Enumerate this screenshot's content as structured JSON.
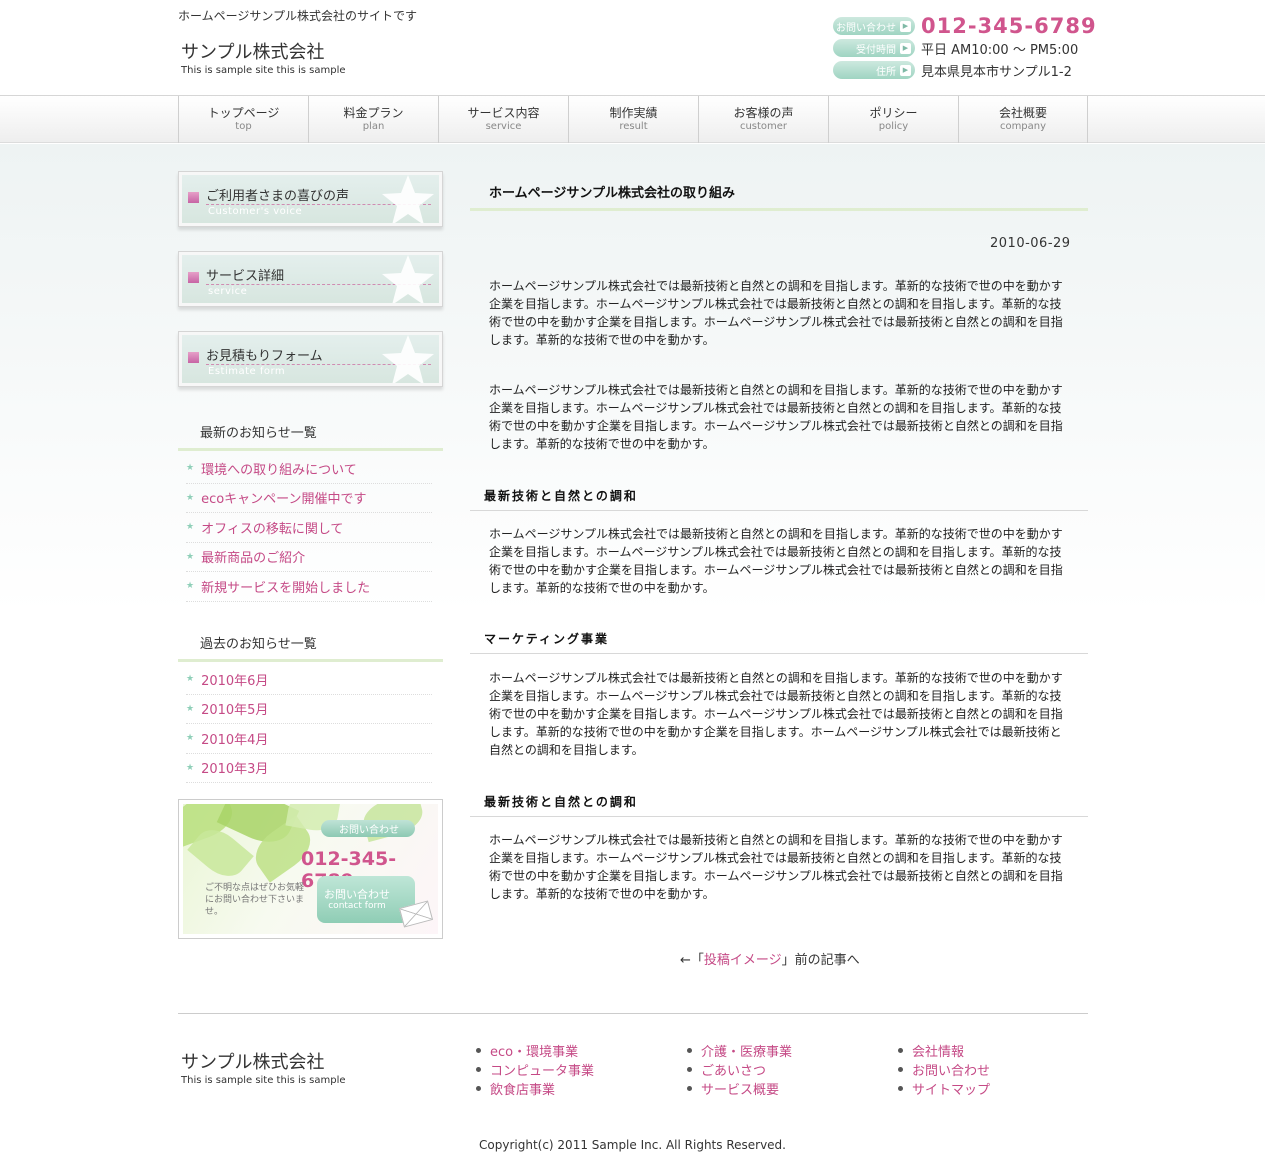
{
  "header": {
    "tagline": "ホームページサンプル株式会社のサイトです",
    "logo_title": "サンプル株式会社",
    "logo_sub": "This is sample site this is sample",
    "contact_label": "お問い合わせ",
    "phone": "012-345-6789",
    "hours_label": "受付時間",
    "hours": "平日 AM10:00 ～ PM5:00",
    "address_label": "住所",
    "address": "見本県見本市サンプル1-2"
  },
  "nav": [
    {
      "ja": "トップページ",
      "en": "top"
    },
    {
      "ja": "料金プラン",
      "en": "plan"
    },
    {
      "ja": "サービス内容",
      "en": "service"
    },
    {
      "ja": "制作実績",
      "en": "result"
    },
    {
      "ja": "お客様の声",
      "en": "customer"
    },
    {
      "ja": "ポリシー",
      "en": "policy"
    },
    {
      "ja": "会社概要",
      "en": "company"
    }
  ],
  "sidebar": {
    "banners": [
      {
        "ja": "ご利用者さまの喜びの声",
        "en": "Customer's voice"
      },
      {
        "ja": "サービス詳細",
        "en": "service"
      },
      {
        "ja": "お見積もりフォーム",
        "en": "Estimate form"
      }
    ],
    "news_heading": "最新のお知らせ一覧",
    "news": [
      "環境への取り組みについて",
      "ecoキャンペーン開催中です",
      "オフィスの移転に関して",
      "最新商品のご紹介",
      "新規サービスを開始しました"
    ],
    "archive_heading": "過去のお知らせ一覧",
    "archive": [
      "2010年6月",
      "2010年5月",
      "2010年4月",
      "2010年3月"
    ],
    "contact": {
      "label": "お問い合わせ",
      "phone": "012-345-6789",
      "note": "ご不明な点はぜひお気軽にお問い合わせ下さいませ。",
      "button_ja": "お問い合わせ",
      "button_en": "contact form"
    }
  },
  "main": {
    "title": "ホームページサンプル株式会社の取り組み",
    "date": "2010-06-29",
    "paragraphs": [
      "ホームページサンプル株式会社では最新技術と自然との調和を目指します。革新的な技術で世の中を動かす企業を目指します。ホームページサンプル株式会社では最新技術と自然との調和を目指します。革新的な技術で世の中を動かす企業を目指します。ホームページサンプル株式会社では最新技術と自然との調和を目指します。革新的な技術で世の中を動かす。",
      "ホームページサンプル株式会社では最新技術と自然との調和を目指します。革新的な技術で世の中を動かす企業を目指します。ホームページサンプル株式会社では最新技術と自然との調和を目指します。革新的な技術で世の中を動かす企業を目指します。ホームページサンプル株式会社では最新技術と自然との調和を目指します。革新的な技術で世の中を動かす。"
    ],
    "sections": [
      {
        "heading": "最新技術と自然との調和",
        "text": "ホームページサンプル株式会社では最新技術と自然との調和を目指します。革新的な技術で世の中を動かす企業を目指します。ホームページサンプル株式会社では最新技術と自然との調和を目指します。革新的な技術で世の中を動かす企業を目指します。ホームページサンプル株式会社では最新技術と自然との調和を目指します。革新的な技術で世の中を動かす。"
      },
      {
        "heading": "マーケティング事業",
        "text": "ホームページサンプル株式会社では最新技術と自然との調和を目指します。革新的な技術で世の中を動かす企業を目指します。ホームページサンプル株式会社では最新技術と自然との調和を目指します。革新的な技術で世の中を動かす企業を目指します。ホームページサンプル株式会社では最新技術と自然との調和を目指します。革新的な技術で世の中を動かす企業を目指します。ホームページサンプル株式会社では最新技術と自然との調和を目指します。"
      },
      {
        "heading": "最新技術と自然との調和",
        "text": "ホームページサンプル株式会社では最新技術と自然との調和を目指します。革新的な技術で世の中を動かす企業を目指します。ホームページサンプル株式会社では最新技術と自然との調和を目指します。革新的な技術で世の中を動かす企業を目指します。ホームページサンプル株式会社では最新技術と自然との調和を目指します。革新的な技術で世の中を動かす。"
      }
    ],
    "prev_prefix": "←「",
    "prev_link": "投稿イメージ",
    "prev_suffix": "」前の記事へ"
  },
  "footer": {
    "logo_title": "サンプル株式会社",
    "logo_sub": "This is sample site this is sample",
    "col1": [
      "eco・環境事業",
      "コンピュータ事業",
      "飲食店事業"
    ],
    "col2": [
      "介護・医療事業",
      "ごあいさつ",
      "サービス概要"
    ],
    "col3": [
      "会社情報",
      "お問い合わせ",
      "サイトマップ"
    ],
    "copyright": "Copyright(c) 2011 Sample Inc. All Rights Reserved."
  },
  "colors": {
    "accent_pink": "#c54a86",
    "phone_pink": "#d0558d",
    "mint": "#9fd4c2",
    "green_line": "#dfedd0"
  }
}
